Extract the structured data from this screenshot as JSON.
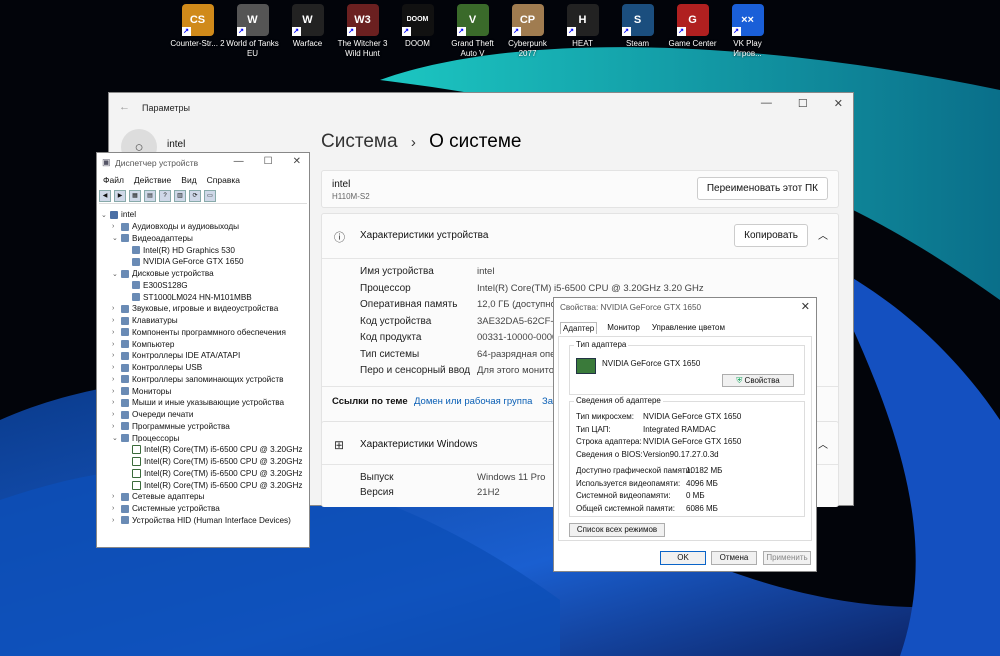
{
  "desktop_icons": [
    {
      "label": "Counter-Str... 2",
      "color": "#d08a1a",
      "glyph": "CS"
    },
    {
      "label": "World of Tanks EU",
      "color": "#555",
      "glyph": "W"
    },
    {
      "label": "Warface",
      "color": "#222",
      "glyph": "W"
    },
    {
      "label": "The Witcher 3 Wild Hunt",
      "color": "#6b2020",
      "glyph": "W3"
    },
    {
      "label": "DOOM",
      "color": "#111",
      "glyph": "DOOM"
    },
    {
      "label": "Grand Theft Auto V",
      "color": "#3a6a2a",
      "glyph": "V"
    },
    {
      "label": "Cyberpunk 2077",
      "color": "#a07c50",
      "glyph": "CP"
    },
    {
      "label": "HEAT",
      "color": "#222",
      "glyph": "H"
    },
    {
      "label": "Steam",
      "color": "#1b4e7e",
      "glyph": "S"
    },
    {
      "label": "Game Center",
      "color": "#b02020",
      "glyph": "G"
    },
    {
      "label": "VK Play Игров...",
      "color": "#1a5fd8",
      "glyph": "××"
    }
  ],
  "settings": {
    "window_title": "Параметры",
    "user": "intel",
    "crumb_parent": "Система",
    "crumb_sep": "›",
    "crumb_current": "О системе",
    "device_name": "intel",
    "device_model": "H110M-S2",
    "rename_button": "Переименовать этот ПК",
    "specs_title": "Характеристики устройства",
    "copy_button": "Копировать",
    "specs": [
      {
        "label": "Имя устройства",
        "value": "intel"
      },
      {
        "label": "Процессор",
        "value": "Intel(R) Core(TM) i5-6500 CPU @ 3.20GHz   3.20 GHz"
      },
      {
        "label": "Оперативная память",
        "value": "12,0 ГБ (доступно:"
      },
      {
        "label": "Код устройства",
        "value": "3AE32DA5-62CF-4D"
      },
      {
        "label": "Код продукта",
        "value": "00331-10000-00001"
      },
      {
        "label": "Тип системы",
        "value": "64-разрядная опер"
      },
      {
        "label": "Перо и сенсорный ввод",
        "value": "Для этого монитор"
      }
    ],
    "links_label": "Ссылки по теме",
    "link1": "Домен или рабочая группа",
    "link2": "Защ",
    "windows_title": "Характеристики Windows",
    "win_specs": [
      {
        "label": "Выпуск",
        "value": "Windows 11 Pro"
      },
      {
        "label": "Версия",
        "value": "21H2"
      }
    ]
  },
  "devmgr": {
    "title": "Диспетчер устройств",
    "menu": [
      "Файл",
      "Действие",
      "Вид",
      "Справка"
    ],
    "tree": [
      {
        "label": "intel",
        "level": 0,
        "exp": "⌄"
      },
      {
        "label": "Аудиовходы и аудиовыходы",
        "level": 1,
        "exp": "›"
      },
      {
        "label": "Видеоадаптеры",
        "level": 1,
        "exp": "⌄"
      },
      {
        "label": "Intel(R) HD Graphics 530",
        "level": 2,
        "exp": ""
      },
      {
        "label": "NVIDIA GeForce GTX 1650",
        "level": 2,
        "exp": ""
      },
      {
        "label": "Дисковые устройства",
        "level": 1,
        "exp": "⌄"
      },
      {
        "label": "E300S128G",
        "level": 2,
        "exp": ""
      },
      {
        "label": "ST1000LM024 HN-M101MBB",
        "level": 2,
        "exp": ""
      },
      {
        "label": "Звуковые, игровые и видеоустройства",
        "level": 1,
        "exp": "›"
      },
      {
        "label": "Клавиатуры",
        "level": 1,
        "exp": "›"
      },
      {
        "label": "Компоненты программного обеспечения",
        "level": 1,
        "exp": "›"
      },
      {
        "label": "Компьютер",
        "level": 1,
        "exp": "›"
      },
      {
        "label": "Контроллеры IDE ATA/ATAPI",
        "level": 1,
        "exp": "›"
      },
      {
        "label": "Контроллеры USB",
        "level": 1,
        "exp": "›"
      },
      {
        "label": "Контроллеры запоминающих устройств",
        "level": 1,
        "exp": "›"
      },
      {
        "label": "Мониторы",
        "level": 1,
        "exp": "›"
      },
      {
        "label": "Мыши и иные указывающие устройства",
        "level": 1,
        "exp": "›"
      },
      {
        "label": "Очереди печати",
        "level": 1,
        "exp": "›"
      },
      {
        "label": "Программные устройства",
        "level": 1,
        "exp": "›"
      },
      {
        "label": "Процессоры",
        "level": 1,
        "exp": "⌄"
      },
      {
        "label": "Intel(R) Core(TM) i5-6500 CPU @ 3.20GHz",
        "level": 2,
        "exp": ""
      },
      {
        "label": "Intel(R) Core(TM) i5-6500 CPU @ 3.20GHz",
        "level": 2,
        "exp": ""
      },
      {
        "label": "Intel(R) Core(TM) i5-6500 CPU @ 3.20GHz",
        "level": 2,
        "exp": ""
      },
      {
        "label": "Intel(R) Core(TM) i5-6500 CPU @ 3.20GHz",
        "level": 2,
        "exp": ""
      },
      {
        "label": "Сетевые адаптеры",
        "level": 1,
        "exp": "›"
      },
      {
        "label": "Системные устройства",
        "level": 1,
        "exp": "›"
      },
      {
        "label": "Устройства HID (Human Interface Devices)",
        "level": 1,
        "exp": "›"
      }
    ]
  },
  "props": {
    "title": "Свойства: NVIDIA GeForce GTX 1650",
    "tabs": [
      "Адаптер",
      "Монитор",
      "Управление цветом"
    ],
    "adapter_group": "Тип адаптера",
    "adapter_name": "NVIDIA GeForce GTX 1650",
    "props_button": "Свойства",
    "info_group": "Сведения об адаптере",
    "info": [
      {
        "k": "Тип микросхем:",
        "v": "NVIDIA GeForce GTX 1650"
      },
      {
        "k": "Тип ЦАП:",
        "v": "Integrated RAMDAC"
      },
      {
        "k": "Строка адаптера:",
        "v": "NVIDIA GeForce GTX 1650"
      },
      {
        "k": "Сведения о BIOS:",
        "v": "Version90.17.27.0.3d"
      }
    ],
    "memory": [
      {
        "k": "Доступно графической памяти:",
        "v": "10182 МБ"
      },
      {
        "k": "Используется видеопамяти:",
        "v": "4096 МБ"
      },
      {
        "k": "Системной видеопамяти:",
        "v": "0 МБ"
      },
      {
        "k": "Общей системной памяти:",
        "v": "6086 МБ"
      }
    ],
    "modes_button": "Список всех режимов",
    "ok": "OK",
    "cancel": "Отмена",
    "apply": "Применить"
  }
}
